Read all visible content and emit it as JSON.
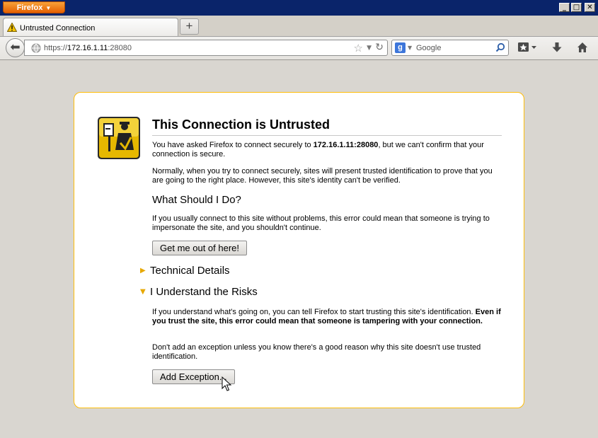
{
  "browser": {
    "app_button": "Firefox",
    "tab_title": "Untrusted Connection",
    "url_scheme": "https://",
    "url_host": "172.16.1.11",
    "url_rest": ":28080",
    "search_engine": "Google",
    "search_placeholder": "Google"
  },
  "page": {
    "title": "This Connection is Untrusted",
    "intro_prefix": "You have asked Firefox to connect securely to ",
    "intro_host": "172.16.1.11:28080",
    "intro_suffix": ", but we can't confirm that your connection is secure.",
    "normal_text": "Normally, when you try to connect securely, sites will present trusted identification to prove that you are going to the right place. However, this site's identity can't be verified.",
    "what_heading": "What Should I Do?",
    "what_text": "If you usually connect to this site without problems, this error could mean that someone is trying to impersonate the site, and you shouldn't continue.",
    "get_out_button": "Get me out of here!",
    "technical_details": "Technical Details",
    "understand_risks": "I Understand the Risks",
    "risks_text_prefix": "If you understand what's going on, you can tell Firefox to start trusting this site's identification. ",
    "risks_text_bold": "Even if you trust the site, this error could mean that someone is tampering with your connection.",
    "exception_text": "Don't add an exception unless you know there's a good reason why this site doesn't use trusted identification.",
    "add_exception_button": "Add Exception..."
  },
  "colors": {
    "accent_orange": "#e66000",
    "card_border": "#ffbd09",
    "titlebar": "#0a246a"
  }
}
